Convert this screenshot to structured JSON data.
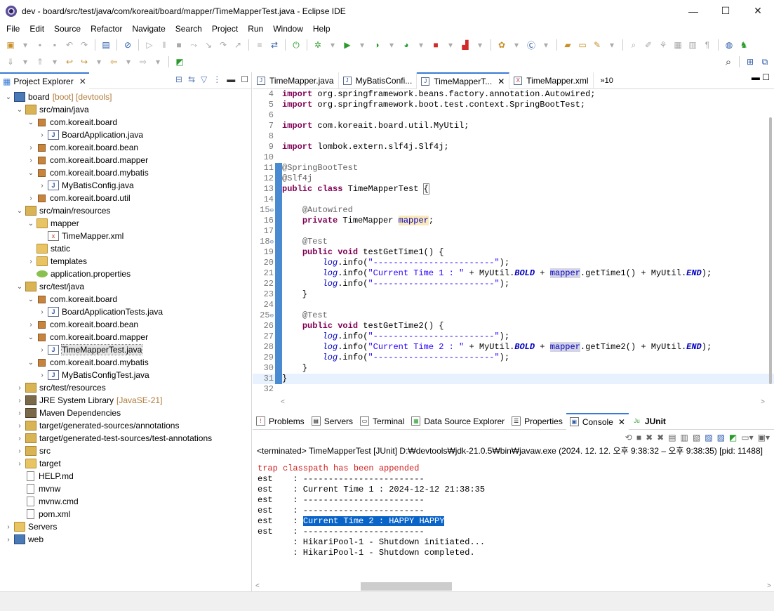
{
  "window": {
    "title": "dev - board/src/test/java/com/koreait/board/mapper/TimeMapperTest.java - Eclipse IDE"
  },
  "menu": [
    "File",
    "Edit",
    "Source",
    "Refactor",
    "Navigate",
    "Search",
    "Project",
    "Run",
    "Window",
    "Help"
  ],
  "explorer": {
    "tab_label": "Project Explorer",
    "tree": [
      {
        "label": "board",
        "suffix": "[boot] [devtools]",
        "icon": "project-icon",
        "depth": 0,
        "twisty": "open"
      },
      {
        "label": "src/main/java",
        "icon": "source-folder-icon",
        "depth": 1,
        "twisty": "open"
      },
      {
        "label": "com.koreait.board",
        "icon": "package-icon",
        "depth": 2,
        "twisty": "open"
      },
      {
        "label": "BoardApplication.java",
        "icon": "java-file-icon",
        "depth": 3,
        "twisty": "closed"
      },
      {
        "label": "com.koreait.board.bean",
        "icon": "package-icon",
        "depth": 2,
        "twisty": "closed"
      },
      {
        "label": "com.koreait.board.mapper",
        "icon": "package-icon",
        "depth": 2,
        "twisty": "closed"
      },
      {
        "label": "com.koreait.board.mybatis",
        "icon": "package-icon",
        "depth": 2,
        "twisty": "open"
      },
      {
        "label": "MyBatisConfig.java",
        "icon": "java-file-icon",
        "depth": 3,
        "twisty": "closed"
      },
      {
        "label": "com.koreait.board.util",
        "icon": "package-icon",
        "depth": 2,
        "twisty": "closed"
      },
      {
        "label": "src/main/resources",
        "icon": "resource-folder-icon",
        "depth": 1,
        "twisty": "open"
      },
      {
        "label": "mapper",
        "icon": "folder-icon",
        "depth": 2,
        "twisty": "open"
      },
      {
        "label": "TimeMapper.xml",
        "icon": "xml-file-icon",
        "depth": 3,
        "twisty": "none"
      },
      {
        "label": "static",
        "icon": "folder-icon",
        "depth": 2,
        "twisty": "none"
      },
      {
        "label": "templates",
        "icon": "folder-icon",
        "depth": 2,
        "twisty": "closed"
      },
      {
        "label": "application.properties",
        "icon": "properties-file-icon",
        "depth": 2,
        "twisty": "none"
      },
      {
        "label": "src/test/java",
        "icon": "source-folder-icon",
        "depth": 1,
        "twisty": "open"
      },
      {
        "label": "com.koreait.board",
        "icon": "package-icon",
        "depth": 2,
        "twisty": "open"
      },
      {
        "label": "BoardApplicationTests.java",
        "icon": "java-file-icon",
        "depth": 3,
        "twisty": "closed"
      },
      {
        "label": "com.koreait.board.bean",
        "icon": "package-icon",
        "depth": 2,
        "twisty": "closed"
      },
      {
        "label": "com.koreait.board.mapper",
        "icon": "package-icon",
        "depth": 2,
        "twisty": "open"
      },
      {
        "label": "TimeMapperTest.java",
        "icon": "java-file-icon",
        "depth": 3,
        "twisty": "closed",
        "selected": true
      },
      {
        "label": "com.koreait.board.mybatis",
        "icon": "package-icon",
        "depth": 2,
        "twisty": "open"
      },
      {
        "label": "MyBatisConfigTest.java",
        "icon": "java-file-icon",
        "depth": 3,
        "twisty": "closed"
      },
      {
        "label": "src/test/resources",
        "icon": "source-folder-icon",
        "depth": 1,
        "twisty": "closed"
      },
      {
        "label": "JRE System Library",
        "suffix": "[JavaSE-21]",
        "icon": "library-icon",
        "depth": 1,
        "twisty": "closed"
      },
      {
        "label": "Maven Dependencies",
        "icon": "library-icon",
        "depth": 1,
        "twisty": "closed"
      },
      {
        "label": "target/generated-sources/annotations",
        "icon": "source-folder-icon",
        "depth": 1,
        "twisty": "closed"
      },
      {
        "label": "target/generated-test-sources/test-annotations",
        "icon": "source-folder-icon",
        "depth": 1,
        "twisty": "closed"
      },
      {
        "label": "src",
        "icon": "resource-folder-icon",
        "depth": 1,
        "twisty": "closed"
      },
      {
        "label": "target",
        "icon": "folder-icon",
        "depth": 1,
        "twisty": "closed"
      },
      {
        "label": "HELP.md",
        "icon": "file-icon",
        "depth": 1,
        "twisty": "none"
      },
      {
        "label": "mvnw",
        "icon": "file-icon",
        "depth": 1,
        "twisty": "none"
      },
      {
        "label": "mvnw.cmd",
        "icon": "file-icon",
        "depth": 1,
        "twisty": "none"
      },
      {
        "label": "pom.xml",
        "icon": "file-icon",
        "depth": 1,
        "twisty": "none"
      },
      {
        "label": "Servers",
        "icon": "folder-icon",
        "depth": 0,
        "twisty": "closed"
      },
      {
        "label": "web",
        "icon": "project-icon",
        "depth": 0,
        "twisty": "closed"
      }
    ]
  },
  "editor": {
    "tabs": [
      {
        "label": "TimeMapper.java",
        "active": false
      },
      {
        "label": "MyBatisConfi...",
        "active": false
      },
      {
        "label": "TimeMapperT...",
        "active": true
      },
      {
        "label": "TimeMapper.xml",
        "active": false
      }
    ],
    "more_tabs": "»10"
  },
  "console": {
    "tabs": [
      {
        "label": "Problems",
        "active": false
      },
      {
        "label": "Servers",
        "active": false
      },
      {
        "label": "Terminal",
        "active": false
      },
      {
        "label": "Data Source Explorer",
        "active": false
      },
      {
        "label": "Properties",
        "active": false
      },
      {
        "label": "Console",
        "active": true
      },
      {
        "label": "JUnit",
        "active": false
      }
    ],
    "status": "<terminated> TimeMapperTest [JUnit] D:₩devtools₩jdk-21.0.5₩bin₩javaw.exe  (2024. 12. 12. 오후 9:38:32 – 오후 9:38:35) [pid: 11488]",
    "lines": [
      {
        "text": "trap classpath has been appended",
        "kind": "err"
      },
      {
        "text": "est    : ------------------------",
        "kind": "out"
      },
      {
        "text": "est    : Current Time 1 : 2024-12-12 21:38:35",
        "kind": "out"
      },
      {
        "text": "est    : ------------------------",
        "kind": "out"
      },
      {
        "text": "est    : ------------------------",
        "kind": "out"
      },
      {
        "text": "est    : ",
        "sel": "Current Time 2 : HAPPY HAPPY",
        "kind": "out"
      },
      {
        "text": "est    : ------------------------",
        "kind": "out"
      },
      {
        "text": "       : HikariPool-1 - Shutdown initiated...",
        "kind": "out"
      },
      {
        "text": "       : HikariPool-1 - Shutdown completed.",
        "kind": "out"
      }
    ]
  }
}
